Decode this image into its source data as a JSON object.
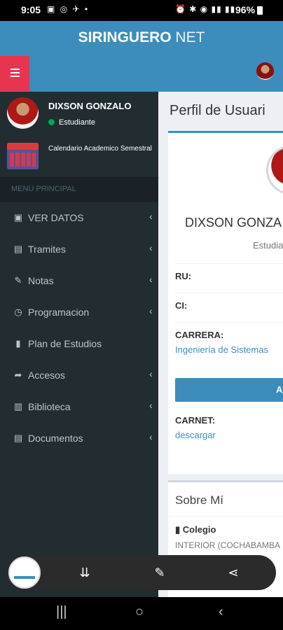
{
  "status_bar": {
    "time": "9:05",
    "notification_icons": "▣ ◎ ✈ •",
    "system_icons": "⏰ ✱ ◉ ▮▮ ▮▮",
    "battery": "96%"
  },
  "header": {
    "brand_bold": "SIRINGUERO",
    "brand_light": " NET"
  },
  "sidebar": {
    "user_name": "DIXSON GONZALO",
    "user_status": "Estudiante",
    "calendar_label": "Calendario Academico Semestral",
    "menu_header": "MENU PRINCIPAL",
    "items": [
      {
        "label": "VER DATOS",
        "icon": "▣",
        "chevron": "‹"
      },
      {
        "label": "Tramites",
        "icon": "▤",
        "chevron": "‹"
      },
      {
        "label": "Notas",
        "icon": "✎",
        "chevron": "‹"
      },
      {
        "label": "Programacion",
        "icon": "◷",
        "chevron": "‹"
      },
      {
        "label": "Plan de Estudios",
        "icon": "▮",
        "chevron": ""
      },
      {
        "label": "Accesos",
        "icon": "➦",
        "chevron": "‹"
      },
      {
        "label": "Biblioteca",
        "icon": "▥",
        "chevron": "‹"
      },
      {
        "label": "Documentos",
        "icon": "▤",
        "chevron": "‹"
      }
    ]
  },
  "content": {
    "page_title": "Perfil de Usuari",
    "profile_name": "DIXSON GONZA",
    "profile_role": "Estudia",
    "fields": [
      {
        "key": "RU:",
        "value": ""
      },
      {
        "key": "CI:",
        "value": ""
      },
      {
        "key": "CARRERA:",
        "value": "Ingeniería de Sistemas"
      }
    ],
    "action_button": "A",
    "carnet_key": "CARNET:",
    "carnet_value": "descargar",
    "about_title": "Sobre Mí",
    "colegio_label": "Colegio",
    "colegio_icon": "▮",
    "colegio_value": "INTERIOR (COCHABAMBA"
  },
  "toolbar": {
    "scroll_capture_icon": "⇊",
    "edit_icon": "✎",
    "share_icon": "⋖"
  },
  "nav_bar": {
    "recents": "|||",
    "home": "○",
    "back": "‹"
  }
}
